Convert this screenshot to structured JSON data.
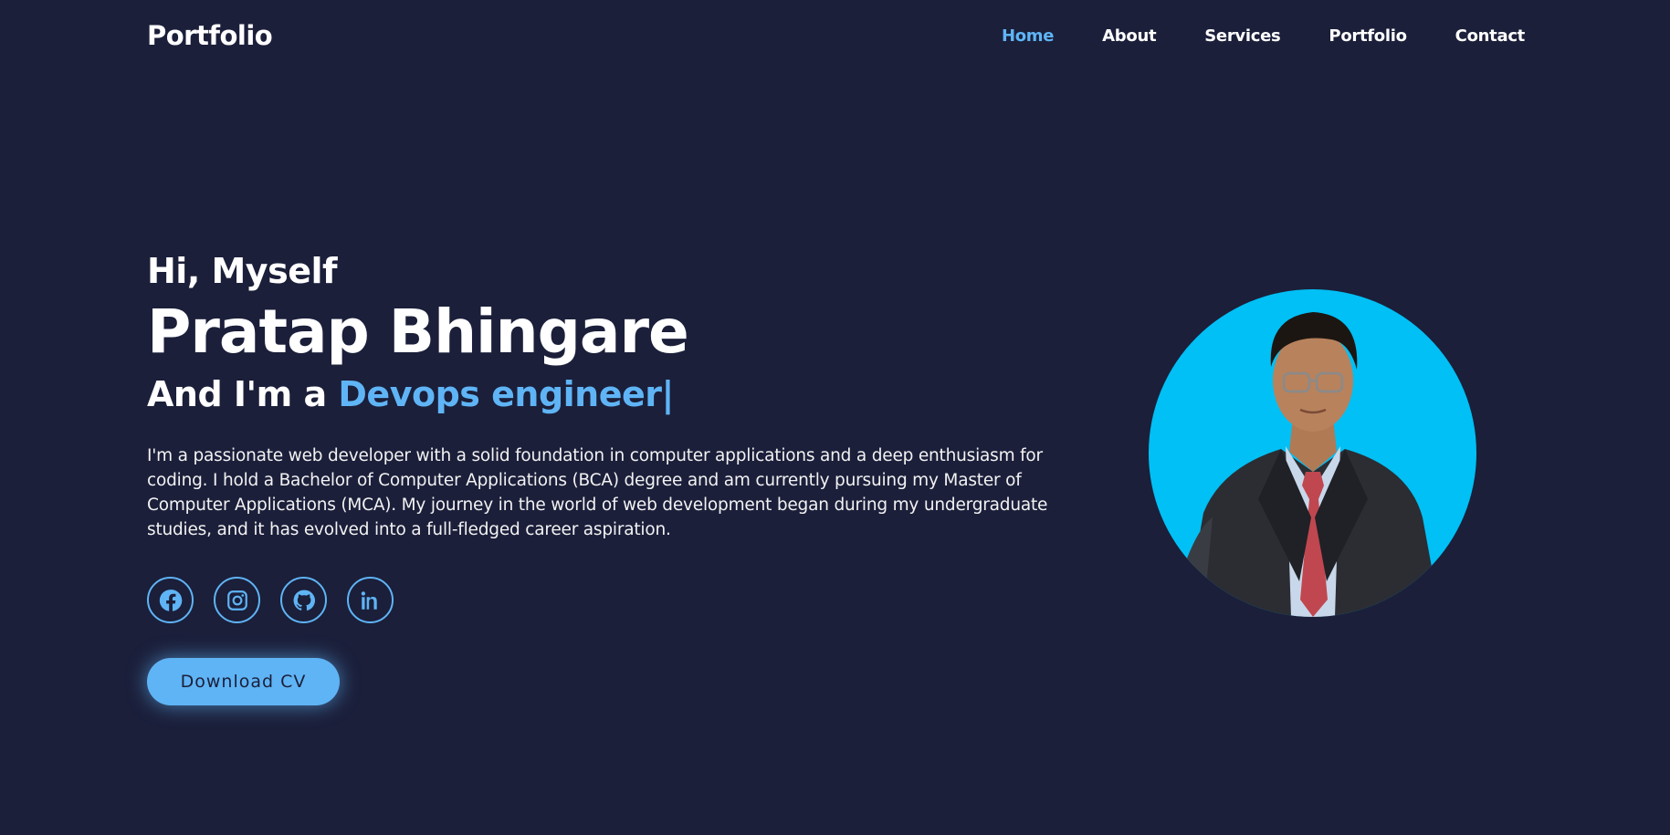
{
  "header": {
    "logo": "Portfolio",
    "nav": [
      {
        "label": "Home",
        "active": true
      },
      {
        "label": "About",
        "active": false
      },
      {
        "label": "Services",
        "active": false
      },
      {
        "label": "Portfolio",
        "active": false
      },
      {
        "label": "Contact",
        "active": false
      }
    ]
  },
  "hero": {
    "greeting": "Hi, Myself",
    "name": "Pratap Bhingare",
    "role_prefix": "And I'm a ",
    "role_highlight": "Devops engineer",
    "role_cursor": "|",
    "bio": "I'm a passionate web developer with a solid foundation in computer applications and a deep enthusiasm for coding. I hold a Bachelor of Computer Applications (BCA) degree and am currently pursuing my Master of Computer Applications (MCA). My journey in the world of web development began during my undergraduate studies, and it has evolved into a full-fledged career aspiration.",
    "socials": [
      "facebook-icon",
      "instagram-icon",
      "github-icon",
      "linkedin-icon"
    ],
    "cv_button": "Download CV"
  },
  "colors": {
    "background": "#1b1f3a",
    "accent": "#5fb4f5",
    "photo_background": "#00c0f5"
  }
}
